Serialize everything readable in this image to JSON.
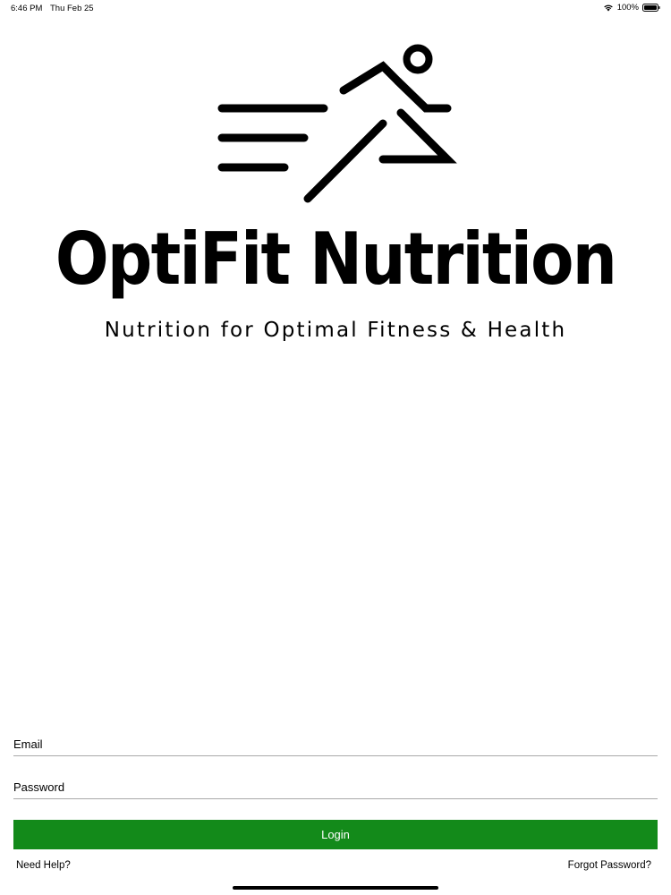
{
  "status_bar": {
    "time": "6:46 PM",
    "date": "Thu Feb 25",
    "battery": "100%"
  },
  "brand": {
    "name": "OptiFit Nutrition",
    "tagline": "Nutrition for Optimal Fitness & Health",
    "logo_icon": "running-person-icon"
  },
  "form": {
    "email_placeholder": "Email",
    "password_placeholder": "Password",
    "login_label": "Login"
  },
  "links": {
    "help": "Need Help?",
    "forgot": "Forgot Password?"
  },
  "colors": {
    "primary": "#138a1a",
    "background": "#ffffff",
    "text": "#000000"
  }
}
